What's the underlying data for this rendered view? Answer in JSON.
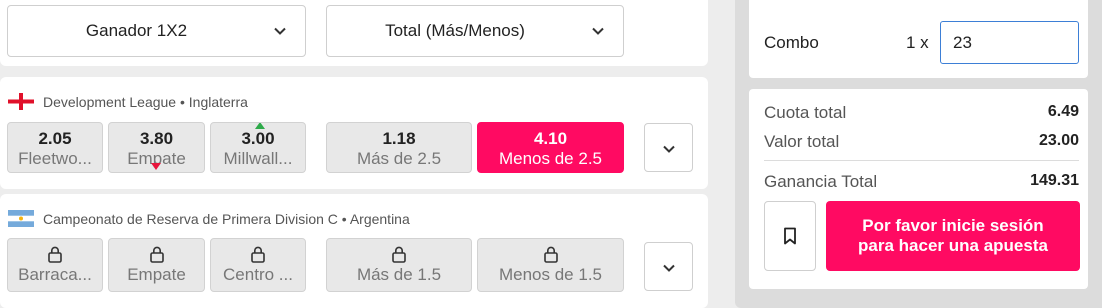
{
  "filters": {
    "market1": "Ganador 1X2",
    "market2": "Total (Más/Menos)"
  },
  "matches": [
    {
      "league": "Development League • Inglaterra",
      "flag": "england-flag",
      "odds": [
        {
          "value": "2.05",
          "label": "Fleetwo..."
        },
        {
          "value": "3.80",
          "label": "Empate"
        },
        {
          "value": "3.00",
          "label": "Millwall..."
        },
        {
          "value": "1.18",
          "label": "Más de 2.5"
        },
        {
          "value": "4.10",
          "label": "Menos de 2.5"
        }
      ]
    },
    {
      "league": "Campeonato de Reserva de Primera Division C • Argentina",
      "flag": "argentina-flag",
      "odds": [
        {
          "label": "Barraca..."
        },
        {
          "label": "Empate"
        },
        {
          "label": "Centro ..."
        },
        {
          "label": "Más de 1.5"
        },
        {
          "label": "Menos de 1.5"
        }
      ]
    }
  ],
  "betslip": {
    "combo_label": "Combo",
    "multiplier": "1 x",
    "stake": "23",
    "total_odds_label": "Cuota total",
    "total_odds": "6.49",
    "total_value_label": "Valor total",
    "total_value": "23.00",
    "total_win_label": "Ganancia Total",
    "total_win": "149.31",
    "login_button": "Por favor inicie sesión para hacer una apuesta"
  },
  "colors": {
    "accent": "#ff0a62",
    "up": "#2eaa4a",
    "down": "#e8143c"
  }
}
